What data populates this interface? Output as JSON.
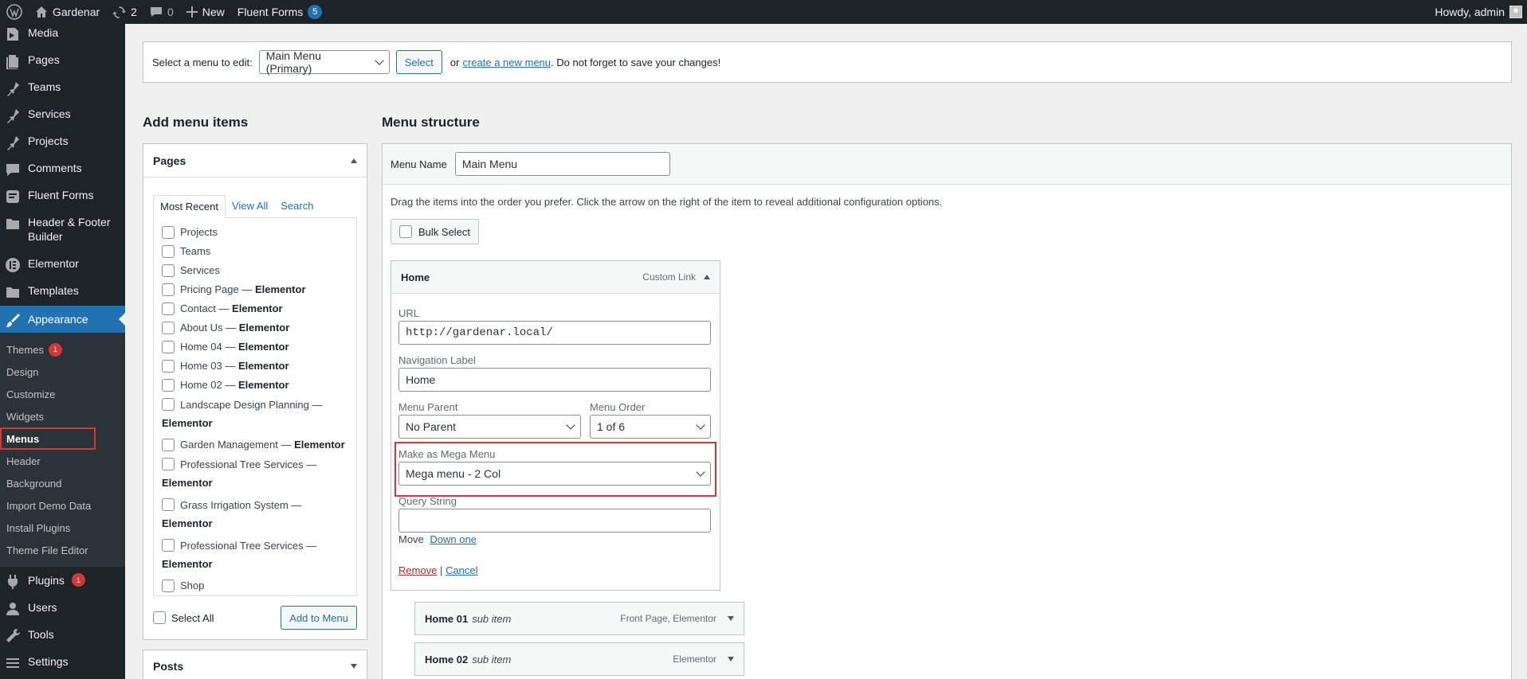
{
  "adminbar": {
    "site_name": "Gardenar",
    "updates_count": "2",
    "comments_count": "0",
    "new_label": "New",
    "fluent_forms_label": "Fluent Forms",
    "fluent_forms_count": "5",
    "howdy": "Howdy, admin"
  },
  "sidebar": {
    "items": [
      {
        "label": "Media",
        "icon": "media-icon"
      },
      {
        "label": "Pages",
        "icon": "pages-icon"
      },
      {
        "label": "Teams",
        "icon": "pin-icon"
      },
      {
        "label": "Services",
        "icon": "pin-icon"
      },
      {
        "label": "Projects",
        "icon": "pin-icon"
      },
      {
        "label": "Comments",
        "icon": "comments-icon"
      },
      {
        "label": "Fluent Forms",
        "icon": "forms-icon"
      },
      {
        "label": "Header & Footer Builder",
        "icon": "folder-icon"
      },
      {
        "label": "Elementor",
        "icon": "elementor-icon"
      },
      {
        "label": "Templates",
        "icon": "folder-icon"
      },
      {
        "label": "Appearance",
        "icon": "brush-icon"
      }
    ],
    "submenu": [
      {
        "label": "Themes",
        "badge": "1"
      },
      {
        "label": "Design"
      },
      {
        "label": "Customize"
      },
      {
        "label": "Widgets"
      },
      {
        "label": "Menus"
      },
      {
        "label": "Header"
      },
      {
        "label": "Background"
      },
      {
        "label": "Import Demo Data"
      },
      {
        "label": "Install Plugins"
      },
      {
        "label": "Theme File Editor"
      }
    ],
    "after": [
      {
        "label": "Plugins",
        "badge": "1",
        "icon": "plugins-icon"
      },
      {
        "label": "Users",
        "icon": "users-icon"
      },
      {
        "label": "Tools",
        "icon": "tools-icon"
      },
      {
        "label": "Settings",
        "icon": "settings-icon"
      }
    ]
  },
  "manage": {
    "label": "Select a menu to edit:",
    "selected_menu": "Main Menu (Primary)",
    "select_button": "Select",
    "or": "or",
    "create_link": "create a new menu",
    "suffix": ". Do not forget to save your changes!"
  },
  "add_items": {
    "title": "Add menu items",
    "pages_title": "Pages",
    "tabs": [
      "Most Recent",
      "View All",
      "Search"
    ],
    "pages": [
      {
        "name": "Projects",
        "tag": ""
      },
      {
        "name": "Teams",
        "tag": ""
      },
      {
        "name": "Services",
        "tag": ""
      },
      {
        "name": "Pricing Page — ",
        "tag": "Elementor"
      },
      {
        "name": "Contact — ",
        "tag": "Elementor"
      },
      {
        "name": "About Us — ",
        "tag": "Elementor"
      },
      {
        "name": "Home 04 — ",
        "tag": "Elementor"
      },
      {
        "name": "Home 03 — ",
        "tag": "Elementor"
      },
      {
        "name": "Home 02 — ",
        "tag": "Elementor"
      },
      {
        "name": "Landscape Design Planning — ",
        "tag": "Elementor"
      },
      {
        "name": "Garden Management — ",
        "tag": "Elementor"
      },
      {
        "name": "Professional Tree Services — ",
        "tag": "Elementor"
      },
      {
        "name": "Grass Irrigation  System — ",
        "tag": "Elementor"
      },
      {
        "name": "Professional Tree Services — ",
        "tag": "Elementor"
      },
      {
        "name": "Shop",
        "tag": ""
      }
    ],
    "select_all": "Select All",
    "add_button": "Add to Menu",
    "posts_title": "Posts"
  },
  "structure": {
    "title": "Menu structure",
    "menu_name_label": "Menu Name",
    "menu_name_value": "Main Menu",
    "instructions": "Drag the items into the order you prefer. Click the arrow on the right of the item to reveal additional configuration options.",
    "bulk_select": "Bulk Select",
    "open_item": {
      "title": "Home",
      "type": "Custom Link",
      "url_label": "URL",
      "url_value": "http://gardenar.local/",
      "nav_label": "Navigation Label",
      "nav_value": "Home",
      "parent_label": "Menu Parent",
      "parent_value": "No Parent",
      "order_label": "Menu Order",
      "order_value": "1 of 6",
      "mega_label": "Make as Mega Menu",
      "mega_value": "Mega menu - 2 Col",
      "query_label": "Query String",
      "query_value": "",
      "move_label": "Move",
      "move_link": "Down one",
      "remove": "Remove",
      "sep": "|",
      "cancel": "Cancel"
    },
    "sub_items": [
      {
        "title": "Home 01",
        "sub": "sub item",
        "type": "Front Page, Elementor"
      },
      {
        "title": "Home 02",
        "sub": "sub item",
        "type": "Elementor"
      }
    ]
  }
}
